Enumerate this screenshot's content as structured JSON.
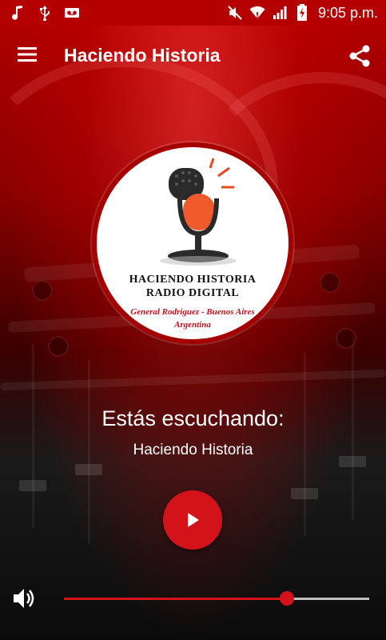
{
  "status_bar": {
    "left_icons": [
      "music-note-icon",
      "usb-icon",
      "voicemail-icon"
    ],
    "right_icons": [
      "mute-icon",
      "wifi-icon",
      "signal-icon",
      "battery-charging-icon"
    ],
    "time": "9:05 p.m."
  },
  "app_bar": {
    "menu_icon": "hamburger-menu-icon",
    "title": "Haciendo Historia",
    "share_icon": "share-icon"
  },
  "logo": {
    "line1": "HACIENDO HISTORIA",
    "line2": "RADIO DIGITAL",
    "place_line1": "General Rodriguez - Buenos Aires",
    "place_line2": "Argentina"
  },
  "now_playing": {
    "heading": "Estás escuchando:",
    "station": "Haciendo Historia"
  },
  "controls": {
    "play_icon": "play-icon",
    "volume_icon": "volume-icon",
    "volume_level": 0.73
  },
  "colors": {
    "accent": "#d3121a",
    "status_bar": "#b40000"
  }
}
